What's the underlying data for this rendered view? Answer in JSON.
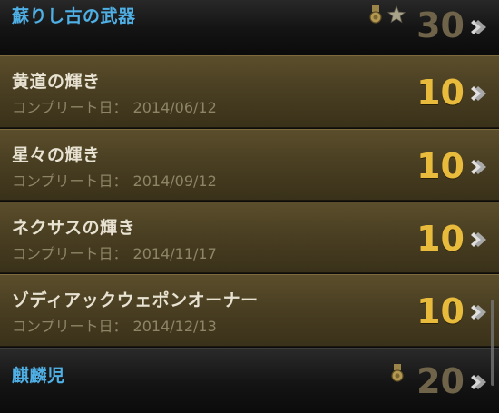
{
  "achievements": [
    {
      "title": "蘇りし古の武器",
      "points": "30",
      "completed": false,
      "badges": [
        "medal-icon",
        "star-icon"
      ]
    },
    {
      "title": "黄道の輝き",
      "complete_label": "コンプリート日：",
      "date": "2014/06/12",
      "points": "10",
      "completed": true
    },
    {
      "title": "星々の輝き",
      "complete_label": "コンプリート日：",
      "date": "2014/09/12",
      "points": "10",
      "completed": true
    },
    {
      "title": "ネクサスの輝き",
      "complete_label": "コンプリート日：",
      "date": "2014/11/17",
      "points": "10",
      "completed": true
    },
    {
      "title": "ゾディアックウェポンオーナー",
      "complete_label": "コンプリート日：",
      "date": "2014/12/13",
      "points": "10",
      "completed": true
    },
    {
      "title": "麒麟児",
      "points": "20",
      "completed": false,
      "badges": [
        "medal-icon"
      ]
    }
  ],
  "colors": {
    "incomplete_title": "#4fb0e6",
    "complete_title": "#e8e2d2",
    "gold_points": "#e9bb3c",
    "muted_points": "#6f644a"
  }
}
